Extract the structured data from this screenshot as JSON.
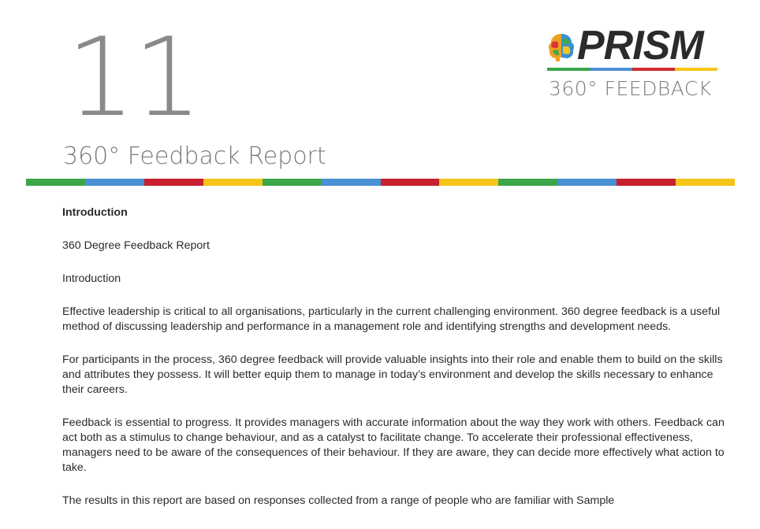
{
  "page": {
    "number": "11",
    "title": "360° Feedback Report"
  },
  "logo": {
    "word": "PRISM",
    "subtitle": "360° FEEDBACK",
    "icon": "brain-icon",
    "stripe_colors": [
      "#3aa648",
      "#4b8fd4",
      "#d42a33",
      "#f5c518"
    ]
  },
  "band_colors": [
    "#3aa648",
    "#4b8fd4",
    "#c8202f",
    "#f5c518",
    "#3aa648",
    "#4b8fd4",
    "#c8202f",
    "#f5c518",
    "#3aa648",
    "#4b8fd4",
    "#c8202f",
    "#f5c518"
  ],
  "content": {
    "heading": "Introduction",
    "line1": "360 Degree Feedback Report",
    "line2": "Introduction",
    "para1": "Effective leadership is critical to all organisations, particularly in the current challenging environment. 360 degree feedback is a useful method of discussing leadership and performance in a management role and identifying strengths and development needs.",
    "para2": "For participants in the process, 360 degree feedback will provide valuable insights into their role and enable them to build on the skills and attributes they possess. It will better equip them to manage in today’s environment and develop the skills necessary to enhance their careers.",
    "para3": "Feedback is essential to progress. It provides managers with accurate information about the way they work with others. Feedback can act both as a stimulus to change behaviour, and as a catalyst to facilitate change.  To accelerate their professional effectiveness, managers need to be aware of the consequences of their behaviour. If they are aware, they can decide more effectively what action to take.",
    "para4": "The results in this report are based on responses collected from a range of people who are familiar with Sample"
  }
}
